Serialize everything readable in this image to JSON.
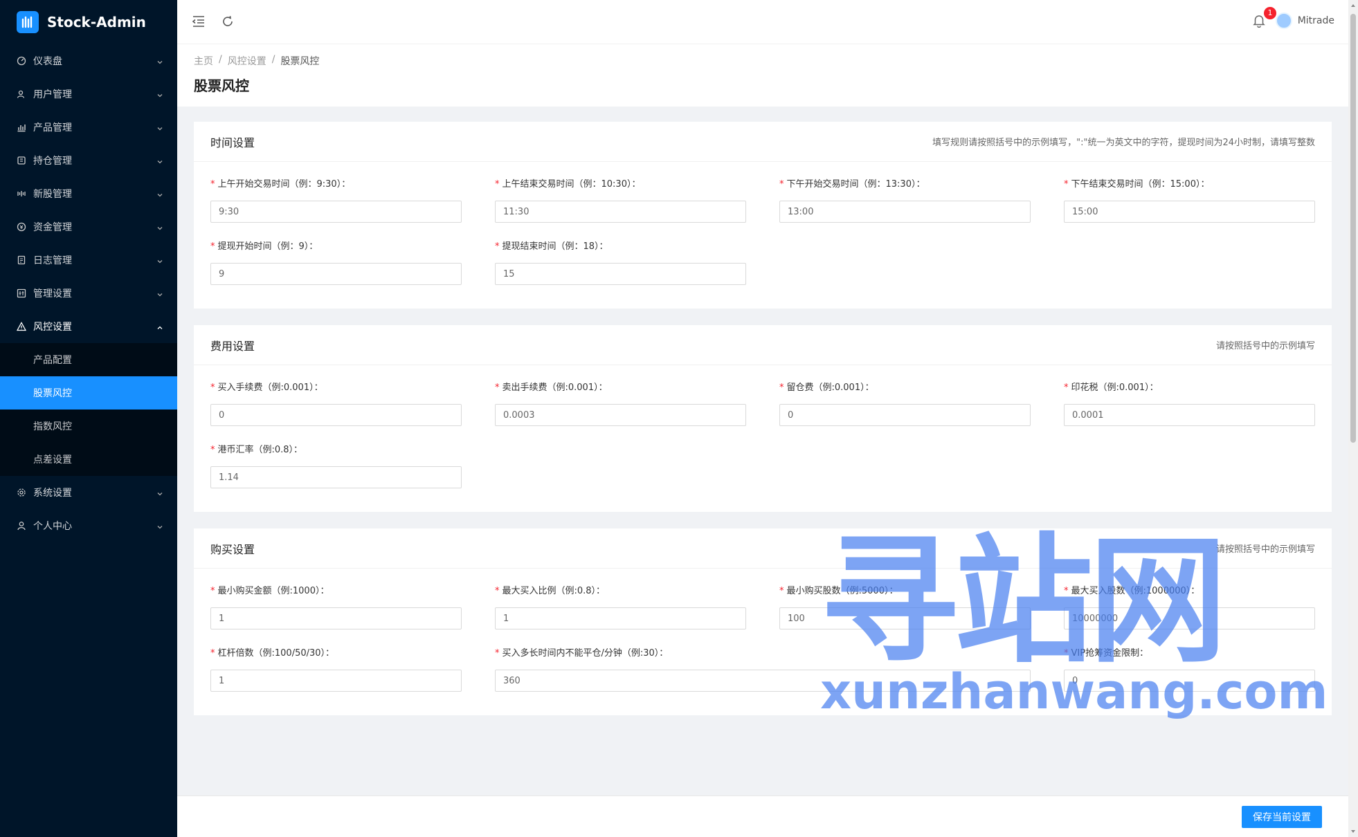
{
  "app": {
    "name": "Stock-Admin"
  },
  "header": {
    "notification_count": "1",
    "username": "Mitrade"
  },
  "sidebar": {
    "items": [
      {
        "label": "仪表盘",
        "icon": "dashboard-icon"
      },
      {
        "label": "用户管理",
        "icon": "users-icon"
      },
      {
        "label": "产品管理",
        "icon": "chart-icon"
      },
      {
        "label": "持仓管理",
        "icon": "position-icon"
      },
      {
        "label": "新股管理",
        "icon": "ipo-icon"
      },
      {
        "label": "资金管理",
        "icon": "money-icon"
      },
      {
        "label": "日志管理",
        "icon": "log-icon"
      },
      {
        "label": "管理设置",
        "icon": "admin-settings-icon"
      },
      {
        "label": "风控设置",
        "icon": "warning-icon",
        "open": true
      },
      {
        "label": "系统设置",
        "icon": "gear-icon"
      },
      {
        "label": "个人中心",
        "icon": "user-icon"
      }
    ],
    "risk_submenu": [
      {
        "label": "产品配置"
      },
      {
        "label": "股票风控",
        "active": true
      },
      {
        "label": "指数风控"
      },
      {
        "label": "点差设置"
      }
    ]
  },
  "breadcrumb": [
    "主页",
    "风控设置",
    "股票风控"
  ],
  "page_title": "股票风控",
  "sections": {
    "time": {
      "title": "时间设置",
      "tip": "填写规则请按照括号中的示例填写，\":\"统一为英文中的字符，提现时间为24小时制，请填写整数",
      "fields": [
        {
          "label": "上午开始交易时间（例：9:30）：",
          "value": "9:30"
        },
        {
          "label": "上午结束交易时间（例：10:30）：",
          "value": "11:30"
        },
        {
          "label": "下午开始交易时间（例：13:30）：",
          "value": "13:00"
        },
        {
          "label": "下午结束交易时间（例：15:00）：",
          "value": "15:00"
        },
        {
          "label": "提现开始时间（例：9）：",
          "value": "9"
        },
        {
          "label": "提现结束时间（例：18）：",
          "value": "15"
        }
      ]
    },
    "fee": {
      "title": "费用设置",
      "tip": "请按照括号中的示例填写",
      "fields": [
        {
          "label": "买入手续费（例:0.001）：",
          "value": "0"
        },
        {
          "label": "卖出手续费（例:0.001）：",
          "value": "0.0003"
        },
        {
          "label": "留仓费（例:0.001）：",
          "value": "0"
        },
        {
          "label": "印花税（例:0.001）：",
          "value": "0.0001"
        },
        {
          "label": "港币汇率（例:0.8）：",
          "value": "1.14"
        }
      ]
    },
    "buy": {
      "title": "购买设置",
      "tip": "请按照括号中的示例填写",
      "fields": [
        {
          "label": "最小购买金额（例:1000）：",
          "value": "1"
        },
        {
          "label": "最大买入比例（例:0.8）：",
          "value": "1"
        },
        {
          "label": "最小购买股数（例:5000）：",
          "value": "100"
        },
        {
          "label": "最大买入股数（例:1000000）：",
          "value": "10000000"
        },
        {
          "label": "杠杆倍数（例:100/50/30）：",
          "value": "1"
        },
        {
          "label": "买入多长时间内不能平仓/分钟（例:30）：",
          "value": "360"
        },
        {
          "label": "VIP抢筹资金限制：",
          "value": "0"
        }
      ]
    }
  },
  "footer": {
    "save_label": "保存当前设置"
  },
  "watermark": {
    "cn": "寻站网",
    "en": "xunzhanwang.com"
  },
  "colors": {
    "sidebar_bg": "#001529",
    "submenu_bg": "#000c17",
    "primary": "#1890ff",
    "required": "#f5222d"
  }
}
